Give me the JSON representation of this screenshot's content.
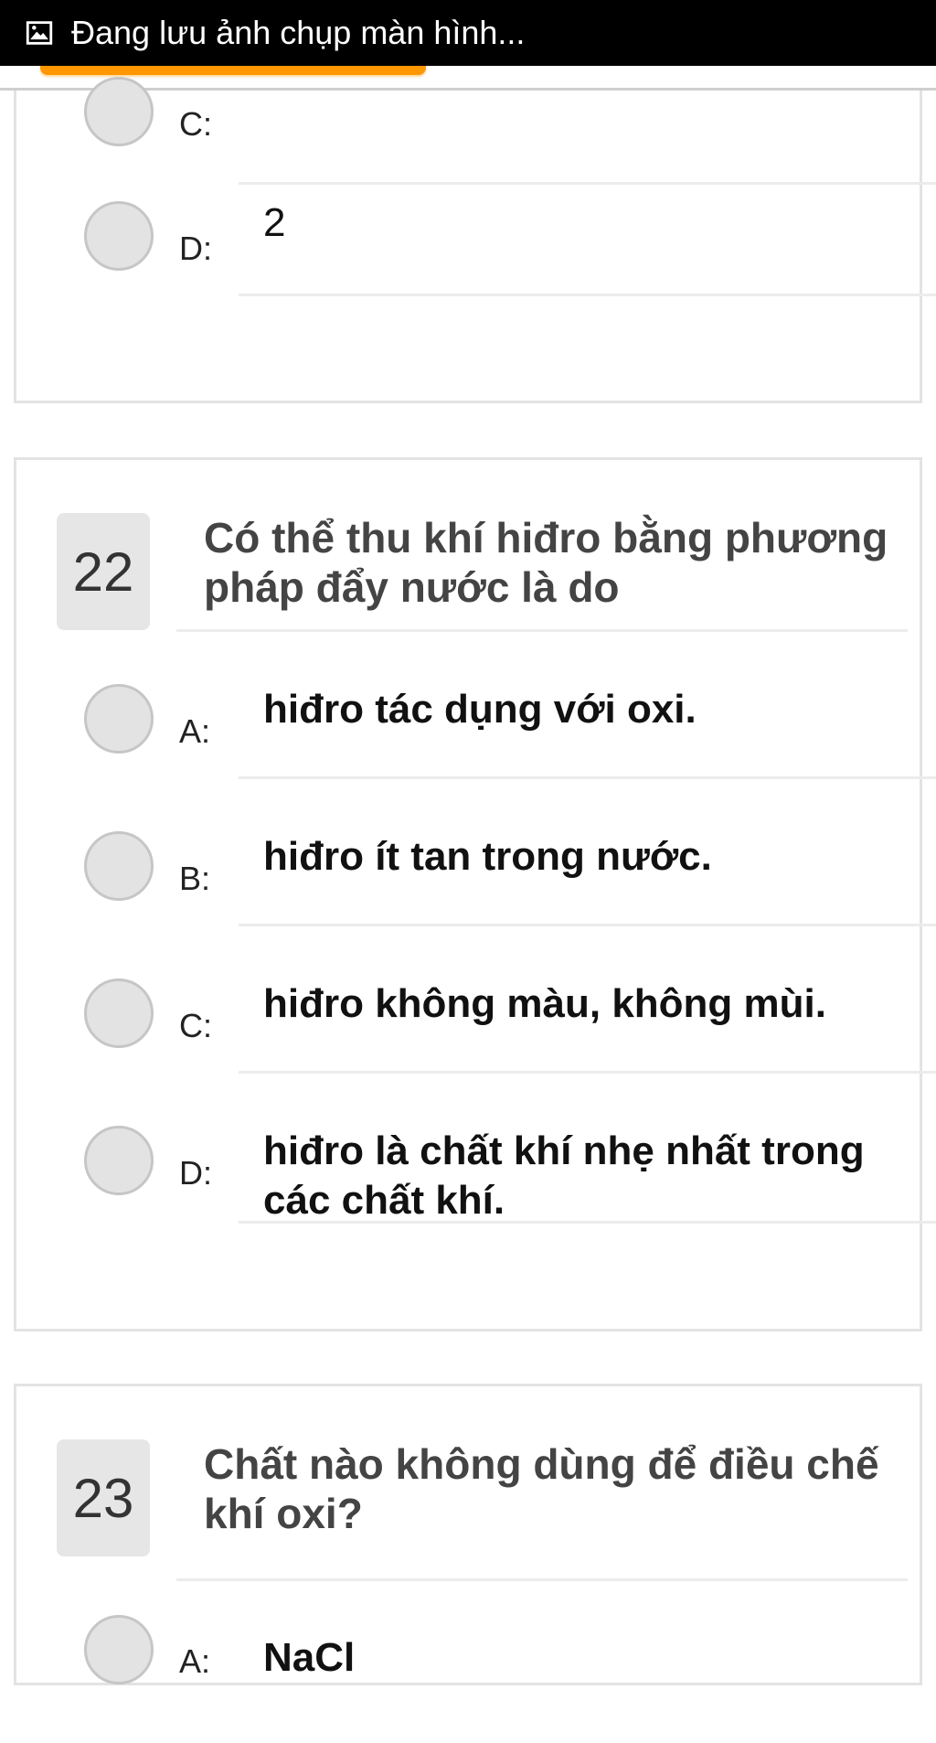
{
  "status_bar": {
    "text": "Đang lưu ảnh chụp màn hình...",
    "icon": "image-icon"
  },
  "colors": {
    "accent": "#ff9800",
    "status_bg": "#000000"
  },
  "q21_partial": {
    "options": [
      {
        "label": "C:",
        "text": ""
      },
      {
        "label": "D:",
        "text": "2"
      }
    ]
  },
  "q22": {
    "number": "22",
    "text": "Có thể thu khí hiđro bằng phương pháp đẩy nước là do",
    "options": [
      {
        "label": "A:",
        "text": "hiđro tác dụng với oxi."
      },
      {
        "label": "B:",
        "text": "hiđro ít tan trong nước."
      },
      {
        "label": "C:",
        "text": "hiđro không màu, không mùi."
      },
      {
        "label": "D:",
        "text": "hiđro là chất khí nhẹ nhất trong các chất khí."
      }
    ]
  },
  "q23": {
    "number": "23",
    "text": "Chất nào không dùng để điều chế khí oxi?",
    "options": [
      {
        "label": "A:",
        "text": "NaCl"
      }
    ]
  }
}
